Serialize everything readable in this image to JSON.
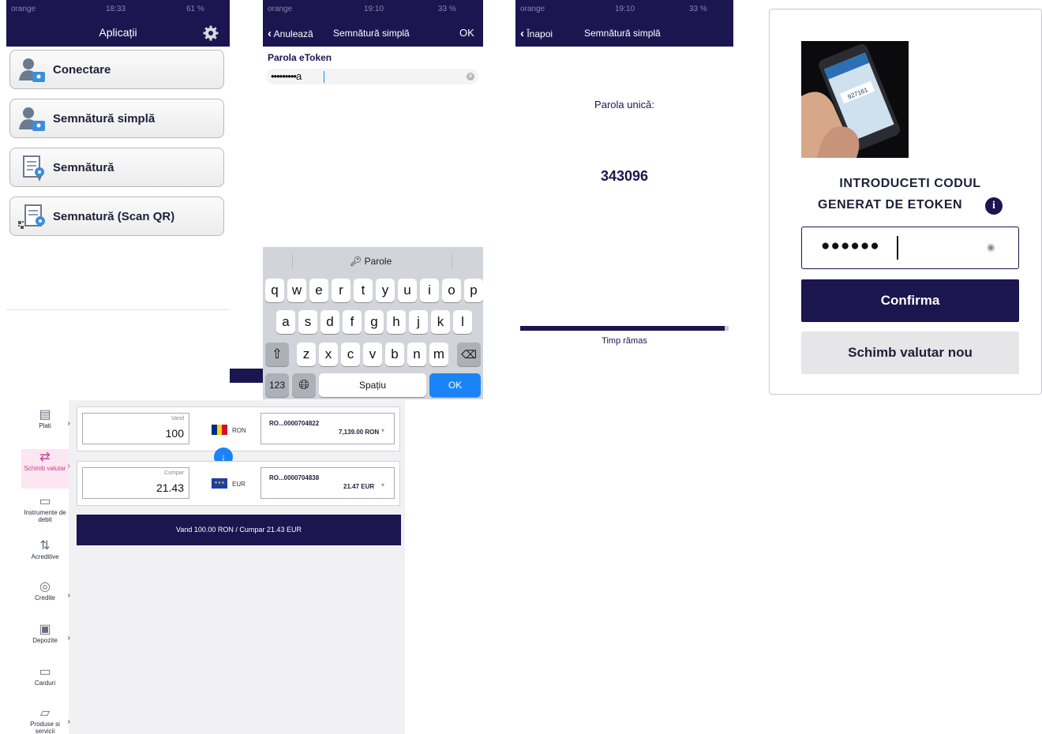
{
  "panel1": {
    "status": {
      "carrier": "orange",
      "time": "18:33",
      "battery": "61 %"
    },
    "title": "Aplicații",
    "buttons": [
      {
        "label": "Conectare",
        "icon": "user-card-icon"
      },
      {
        "label": "Semnătură simplă",
        "icon": "user-card-icon"
      },
      {
        "label": "Semnătură",
        "icon": "document-sign-icon"
      },
      {
        "label": "Semnatură (Scan QR)",
        "icon": "qr-document-sign-icon"
      }
    ]
  },
  "panel2": {
    "status": {
      "carrier": "orange",
      "time": "19:10",
      "battery": "33 %"
    },
    "cancel": "Anulează",
    "title": "Semnătură simplă",
    "ok": "OK",
    "field_label": "Parola eToken",
    "field_value": "•••••••••a",
    "keyboard": {
      "suggestion": "Parole",
      "row1": [
        "q",
        "w",
        "e",
        "r",
        "t",
        "y",
        "u",
        "i",
        "o",
        "p"
      ],
      "row2": [
        "a",
        "s",
        "d",
        "f",
        "g",
        "h",
        "j",
        "k",
        "l"
      ],
      "row3": [
        "z",
        "x",
        "c",
        "v",
        "b",
        "n",
        "m"
      ],
      "numbers": "123",
      "space": "Spațiu",
      "return": "OK"
    }
  },
  "panel3": {
    "status": {
      "carrier": "orange",
      "time": "19:10",
      "battery": "33 %"
    },
    "back": "Înapoi",
    "title": "Semnătură simplă",
    "otp_label": "Parola unică:",
    "otp_value": "343096",
    "timer_label": "Timp rămas",
    "timer_fraction": 0.98
  },
  "panel4": {
    "photo_code": "927161",
    "prompt_line1": "INTRODUCETI CODUL",
    "prompt_line2": "GENERAT DE ETOKEN",
    "input_value": "●●●●●●",
    "confirm": "Confirma",
    "secondary": "Schimb valutar nou"
  },
  "panel5": {
    "sidebar": [
      {
        "label": "Plati",
        "icon": "payments-icon",
        "active": false,
        "arrow": true
      },
      {
        "label": "Schimb valutar",
        "icon": "exchange-icon",
        "active": true,
        "arrow": true
      },
      {
        "label": "Instrumente de debit",
        "icon": "debit-instruments-icon",
        "active": false,
        "arrow": false
      },
      {
        "label": "Acreditive",
        "icon": "letters-of-credit-icon",
        "active": false,
        "arrow": false
      },
      {
        "label": "Credite",
        "icon": "credits-icon",
        "active": false,
        "arrow": true
      },
      {
        "label": "Depozite",
        "icon": "deposits-icon",
        "active": false,
        "arrow": true
      },
      {
        "label": "Carduri",
        "icon": "cards-icon",
        "active": false,
        "arrow": false
      },
      {
        "label": "Produse si servicii",
        "icon": "products-icon",
        "active": false,
        "arrow": true
      }
    ],
    "sell": {
      "caption": "Vand",
      "value": "100",
      "currency": "RON",
      "account": "RO...0000704822",
      "balance": "7,139.00 RON"
    },
    "buy": {
      "caption": "Cumpar",
      "value": "21.43",
      "currency": "EUR",
      "account": "RO...0000704838",
      "balance": "21.47 EUR"
    },
    "summary": "Vand 100.00 RON / Cumpar 21.43 EUR"
  },
  "colors": {
    "brand_navy": "#1b1550",
    "ios_blue": "#1a84f7",
    "accent_pink": "#d03a8c"
  }
}
